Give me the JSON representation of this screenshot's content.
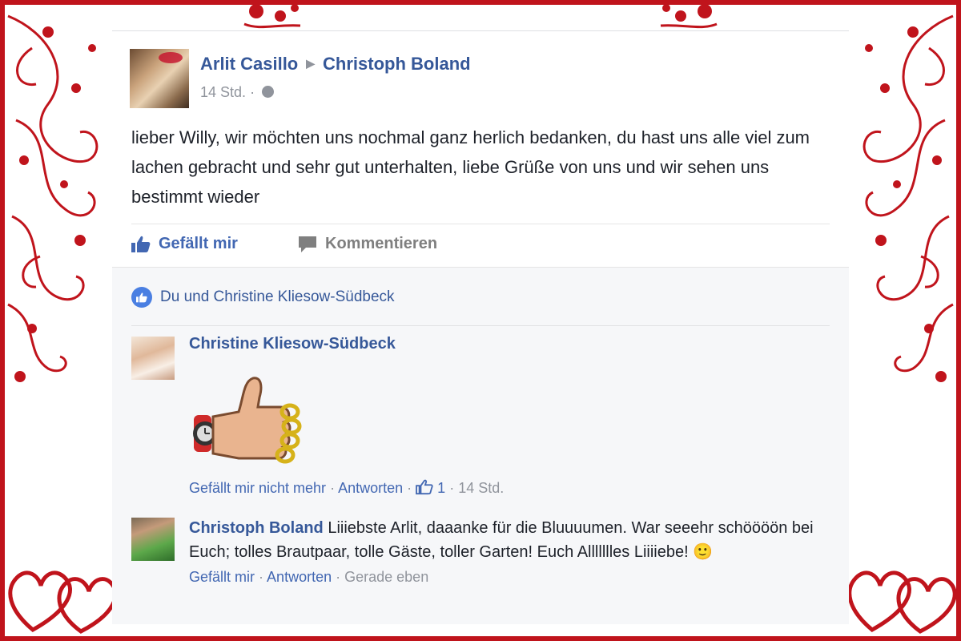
{
  "post": {
    "author": "Arlit Casillo",
    "target": "Christoph Boland",
    "time": "14 Std.",
    "meta_separator": "·",
    "text": "lieber Willy, wir möchten uns nochmal ganz herlich bedanken, du hast uns alle viel zum lachen gebracht und sehr gut unterhalten, liebe Grüße von uns und wir sehen uns bestimmt wieder"
  },
  "actions": {
    "like": "Gefällt mir",
    "comment": "Kommentieren"
  },
  "likes_summary": "Du und Christine Kliesow-Südbeck",
  "comments": [
    {
      "author": "Christine Kliesow-Südbeck",
      "sticker": "thumbs-up-sticker",
      "actions": {
        "unlike": "Gefällt mir nicht mehr",
        "reply": "Antworten",
        "like_count": "1",
        "time": "14 Std.",
        "sep": "·"
      }
    },
    {
      "author": "Christoph Boland",
      "text": "Liiiebste Arlit, daaanke für die Bluuuumen. War seeehr schöööön bei Euch; tolles Brautpaar, tolle Gäste, toller Garten! Euch Allllllles Liiiiebe!",
      "emoji": "🙂",
      "actions": {
        "like": "Gefällt mir",
        "reply": "Antworten",
        "time": "Gerade eben",
        "sep": "·"
      }
    }
  ],
  "colors": {
    "frame": "#c0141c",
    "fb_link": "#365899",
    "fb_blue": "#4267b2",
    "meta_gray": "#90949c"
  }
}
